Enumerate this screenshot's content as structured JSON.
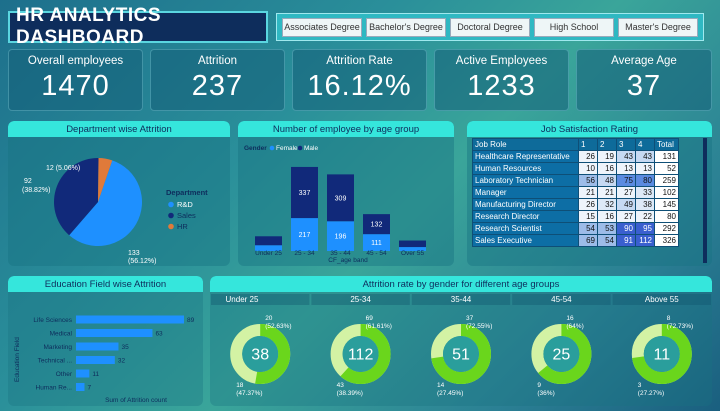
{
  "title": "HR ANALYTICS DASHBOARD",
  "slicer": [
    "Associates Degree",
    "Bachelor's Degree",
    "Doctoral Degree",
    "High School",
    "Master's Degree"
  ],
  "kpis": [
    {
      "label": "Overall employees",
      "value": "1470"
    },
    {
      "label": "Attrition",
      "value": "237"
    },
    {
      "label": "Attrition Rate",
      "value": "16.12%"
    },
    {
      "label": "Active Employees",
      "value": "1233"
    },
    {
      "label": "Average Age",
      "value": "37"
    }
  ],
  "dept": {
    "title": "Department wise Attrition",
    "legend_title": "Department",
    "chart_data": {
      "type": "pie",
      "labels": [
        "R&D",
        "Sales",
        "HR"
      ],
      "values": [
        133,
        92,
        12
      ],
      "percents": [
        "56.12%",
        "38.82%",
        "5.06%"
      ],
      "colors": [
        "#1e90ff",
        "#11297a",
        "#e07a3a"
      ]
    }
  },
  "age": {
    "title": "Number of employee by age group",
    "legend_label": "Gender",
    "xlabel": "CF_age band",
    "chart_data": {
      "type": "bar",
      "categories": [
        "Under 25",
        "25 - 34",
        "35 - 44",
        "45 - 54",
        "Over 55"
      ],
      "series": [
        {
          "name": "Female",
          "values": [
            38,
            217,
            196,
            111,
            26
          ],
          "color": "#1e90ff"
        },
        {
          "name": "Male",
          "values": [
            59,
            337,
            309,
            132,
            43
          ],
          "color": "#11297a"
        }
      ],
      "labels_female": [
        "",
        "217",
        "196",
        "111",
        ""
      ],
      "labels_male": [
        "",
        "337",
        "309",
        "132",
        ""
      ]
    }
  },
  "jsr": {
    "title": "Job Satisfaction Rating",
    "headers": [
      "Job Role",
      "1",
      "2",
      "3",
      "4",
      "Total"
    ],
    "rows": [
      [
        "Healthcare Representative",
        "26",
        "19",
        "43",
        "43",
        "131"
      ],
      [
        "Human Resources",
        "10",
        "16",
        "13",
        "13",
        "52"
      ],
      [
        "Laboratory Technician",
        "56",
        "48",
        "75",
        "80",
        "259"
      ],
      [
        "Manager",
        "21",
        "21",
        "27",
        "33",
        "102"
      ],
      [
        "Manufacturing Director",
        "26",
        "32",
        "49",
        "38",
        "145"
      ],
      [
        "Research Director",
        "15",
        "16",
        "27",
        "22",
        "80"
      ],
      [
        "Research Scientist",
        "54",
        "53",
        "90",
        "95",
        "292"
      ],
      [
        "Sales Executive",
        "69",
        "54",
        "91",
        "112",
        "326"
      ]
    ]
  },
  "edu": {
    "title": "Education Field wise Attrition",
    "ylabel": "Education Field",
    "xlabel": "Sum of Attrition count",
    "chart_data": {
      "type": "bar",
      "categories": [
        "Life Sciences",
        "Medical",
        "Marketing",
        "Technical ...",
        "Other",
        "Human Re..."
      ],
      "values": [
        89,
        63,
        35,
        32,
        11,
        7
      ],
      "color": "#1e90ff"
    }
  },
  "gender": {
    "title": "Attrition rate by gender for different age groups",
    "chart_data": {
      "type": "pie",
      "groups": [
        {
          "label": "Under 25",
          "total": "38",
          "top": "20",
          "top_pct": "(52.63%)",
          "bottom": "18",
          "bottom_pct": "(47.37%)",
          "green_fraction": 0.5263
        },
        {
          "label": "25-34",
          "total": "112",
          "top": "69",
          "top_pct": "(61.61%)",
          "bottom": "43",
          "bottom_pct": "(38.39%)",
          "green_fraction": 0.6161
        },
        {
          "label": "35-44",
          "total": "51",
          "top": "37",
          "top_pct": "(72.55%)",
          "bottom": "14",
          "bottom_pct": "(27.45%)",
          "green_fraction": 0.7255
        },
        {
          "label": "45-54",
          "total": "25",
          "top": "16",
          "top_pct": "(64%)",
          "bottom": "9",
          "bottom_pct": "(36%)",
          "green_fraction": 0.64
        },
        {
          "label": "Above 55",
          "total": "11",
          "top": "8",
          "top_pct": "(72.73%)",
          "bottom": "3",
          "bottom_pct": "(27.27%)",
          "green_fraction": 0.7273
        }
      ],
      "colors": {
        "green": "#6ad61c",
        "light": "#d3f2a4"
      }
    }
  }
}
